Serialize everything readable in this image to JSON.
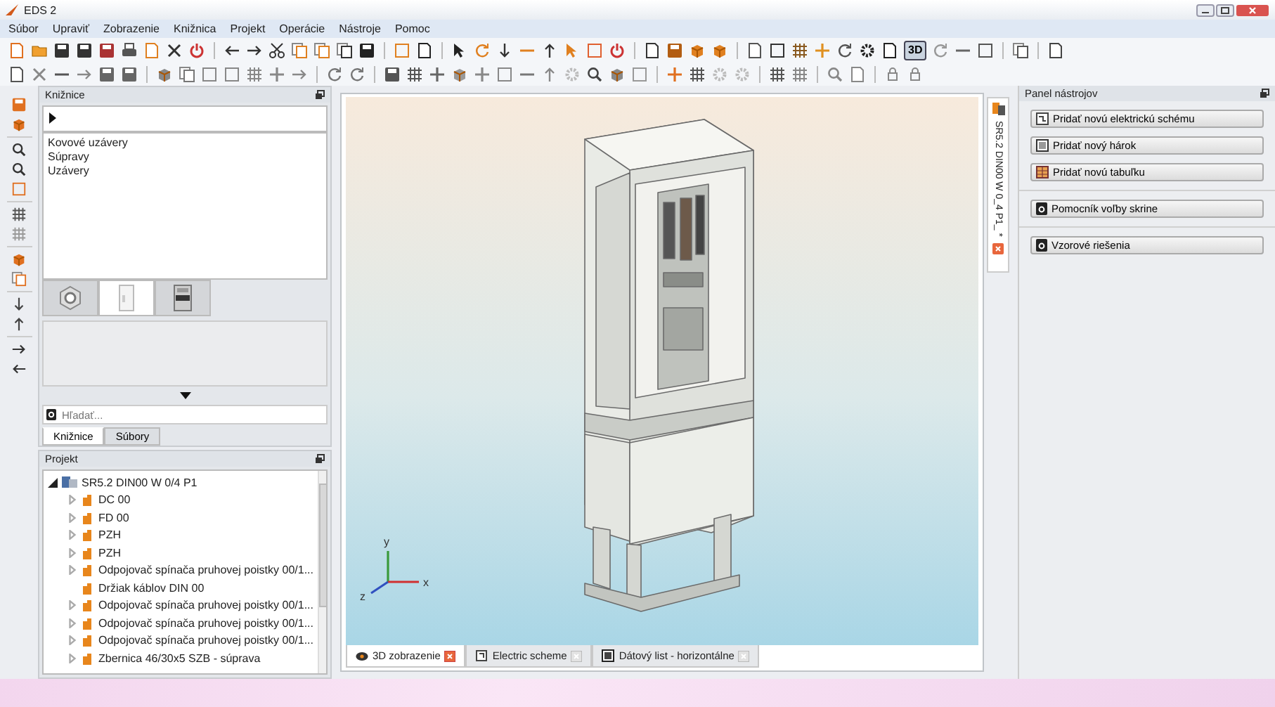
{
  "window": {
    "title": "EDS 2"
  },
  "menu": [
    "Súbor",
    "Upraviť",
    "Zobrazenie",
    "Knižnica",
    "Projekt",
    "Operácie",
    "Nástroje",
    "Pomoc"
  ],
  "toolbar": {
    "view_3d_button": {
      "label": "3D",
      "selected": true
    }
  },
  "library_panel": {
    "title": "Knižnice",
    "items": [
      "Kovové uzávery",
      "Súpravy",
      "Uzávery"
    ],
    "category_tabs": [
      {
        "kind": "nut",
        "selected": false
      },
      {
        "kind": "cabinet",
        "selected": true
      },
      {
        "kind": "breaker",
        "selected": false
      }
    ],
    "search": {
      "placeholder": "Hľadať..."
    },
    "tabs": [
      {
        "label": "Knižnice",
        "selected": true
      },
      {
        "label": "Súbory",
        "selected": false
      }
    ]
  },
  "project_panel": {
    "title": "Projekt",
    "tree": [
      {
        "label": "SR5.2 DIN00 W 0/4 P1",
        "expandable": true,
        "expanded": true,
        "children": [
          {
            "label": "DC 00",
            "expandable": true,
            "expanded": false
          },
          {
            "label": "FD 00",
            "expandable": true,
            "expanded": false
          },
          {
            "label": "PZH",
            "expandable": true,
            "expanded": false
          },
          {
            "label": "PZH",
            "expandable": true,
            "expanded": false
          },
          {
            "label": "Odpojovač spínača pruhovej poistky 00/1...",
            "expandable": true,
            "expanded": false
          },
          {
            "label": "Držiak káblov DIN 00",
            "expandable": false,
            "expanded": false
          },
          {
            "label": "Odpojovač spínača pruhovej poistky 00/1...",
            "expandable": true,
            "expanded": false
          },
          {
            "label": "Odpojovač spínača pruhovej poistky 00/1...",
            "expandable": true,
            "expanded": false
          },
          {
            "label": "Odpojovač spínača pruhovej poistky 00/1...",
            "expandable": true,
            "expanded": false
          },
          {
            "label": "Zbernica 46/30x5 SZB - súprava",
            "expandable": true,
            "expanded": false
          }
        ]
      }
    ]
  },
  "viewport": {
    "axis_labels": [
      "y",
      "z",
      "x"
    ],
    "tabs": [
      {
        "label": "3D zobrazenie",
        "selected": true
      },
      {
        "label": "Electric scheme",
        "selected": false
      },
      {
        "label": "Dátový list - horizontálne",
        "selected": false
      }
    ]
  },
  "document_tab": {
    "label": "SR5.2 DIN00 W 0_4 P1_ *"
  },
  "tool_panel": {
    "title": "Panel nástrojov",
    "groups": [
      [
        "Pridať novú elektrickú schému",
        "Pridať nový hárok",
        "Pridať novú tabuľku"
      ],
      [
        "Pomocník voľby skrine"
      ],
      [
        "Vzorové riešenia"
      ]
    ]
  }
}
